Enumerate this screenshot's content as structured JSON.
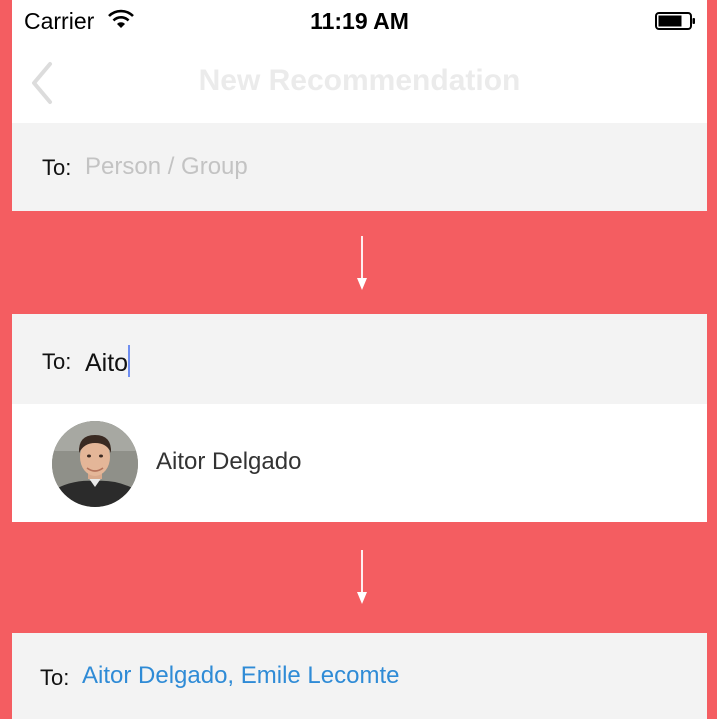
{
  "status_bar": {
    "carrier": "Carrier",
    "time": "11:19 AM"
  },
  "nav": {
    "title": "New Recommendation"
  },
  "step1": {
    "to_label": "To:",
    "placeholder": "Person / Group"
  },
  "step2": {
    "to_label": "To:",
    "typed_value": "Aito",
    "suggestion": {
      "name": "Aitor Delgado"
    }
  },
  "step3": {
    "to_label": "To:",
    "recipients": "Aitor Delgado, Emile Lecomte"
  },
  "colors": {
    "background": "#f45d61",
    "link_blue": "#2f8bd6",
    "placeholder_gray": "#c3c3c3",
    "cursor": "#6f8ef0"
  },
  "icons": [
    "wifi-icon",
    "battery-icon",
    "chevron-left-icon",
    "arrow-down-icon"
  ]
}
